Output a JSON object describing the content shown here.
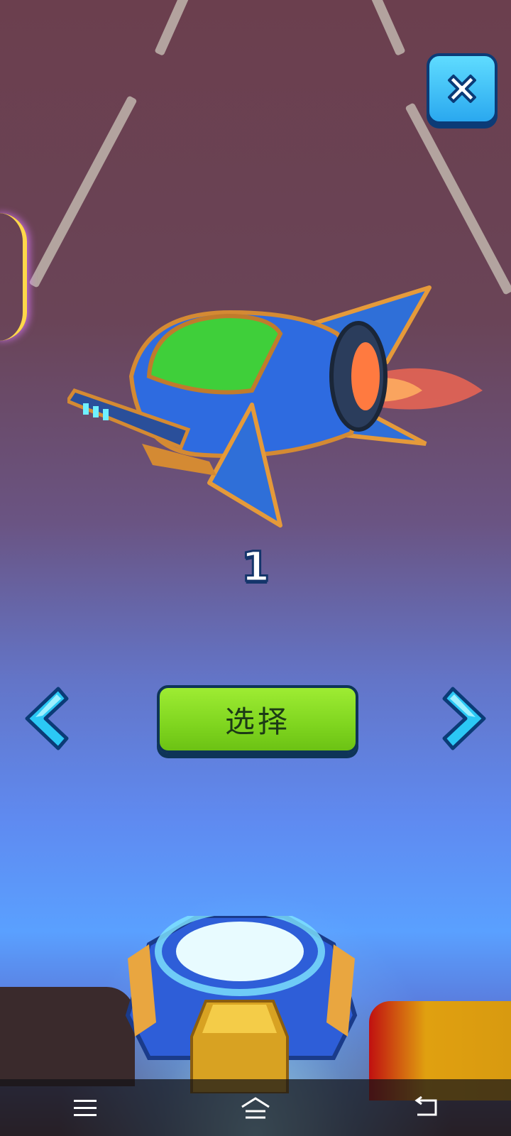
{
  "game": {
    "level_label": "1",
    "select_button_label": "选择"
  },
  "icons": {
    "close": "close-icon",
    "prev": "chevron-left-icon",
    "next": "chevron-right-icon",
    "nav_menu": "menu-icon",
    "nav_home": "home-icon",
    "nav_back": "back-icon"
  },
  "colors": {
    "select_button": "#8ee02a",
    "close_button": "#3cc0f5",
    "arrow": "#2bc8f5",
    "outline": "#0e3458"
  }
}
